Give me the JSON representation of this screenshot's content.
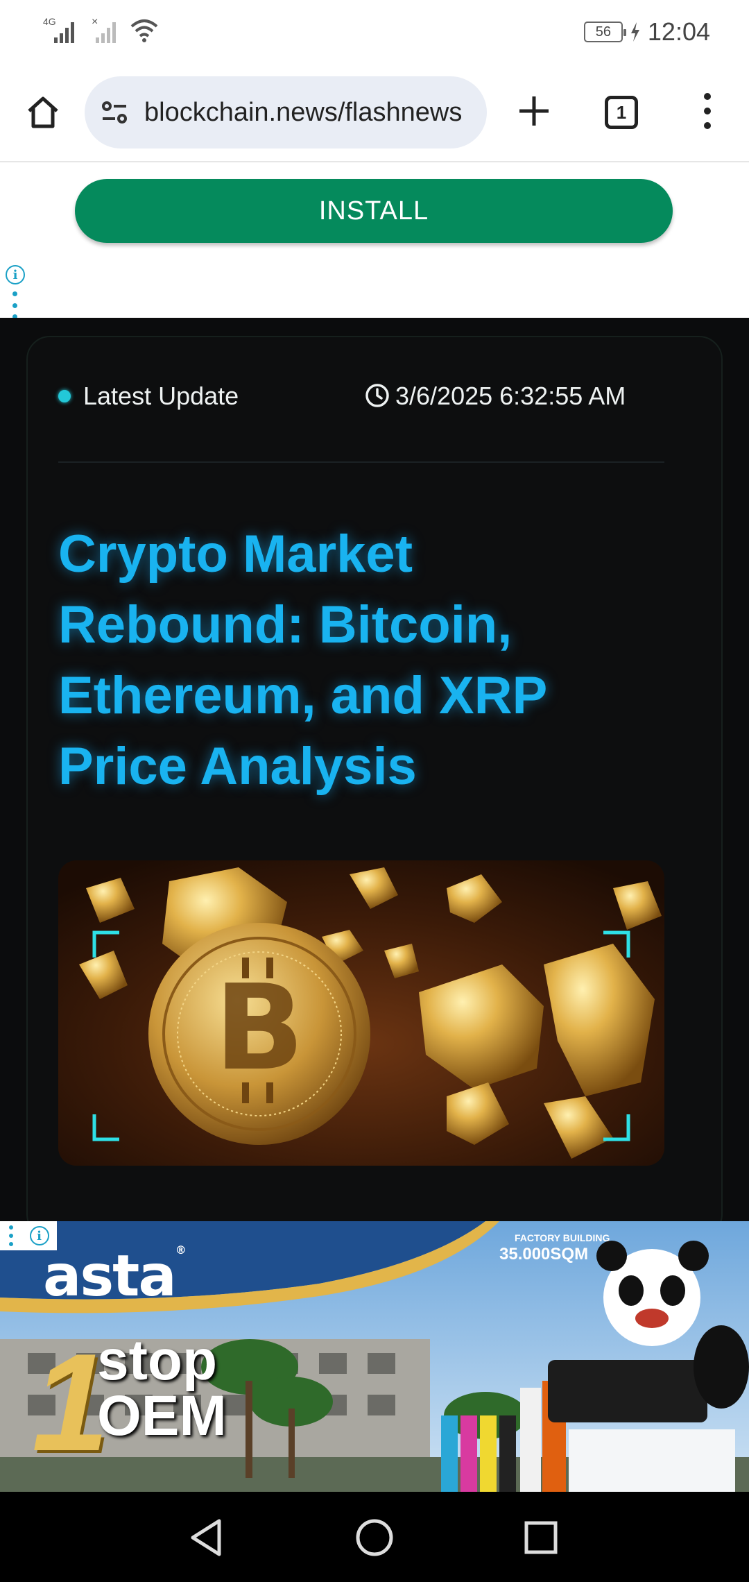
{
  "status_bar": {
    "network": "4G",
    "battery": "56",
    "time": "12:04"
  },
  "browser": {
    "url": "blockchain.news/flashnews",
    "tab_count": "1"
  },
  "top_ad": {
    "install_label": "INSTALL"
  },
  "article": {
    "badge": "Latest Update",
    "timestamp": "3/6/2025 6:32:55 AM",
    "title": "Crypto Market Rebound: Bitcoin, Ethereum, and XRP Price Analysis",
    "image": "bitcoin-gold-nuggets"
  },
  "bottom_ad": {
    "brand": "asta",
    "brand_mark": "®",
    "factory_label": "FACTORY BUILDING",
    "factory_size": "35.000SQM",
    "slogan_number": "1",
    "slogan_line1": "stop",
    "slogan_line2": "OEM"
  },
  "colors": {
    "install_green": "#058a5c",
    "title_cyan": "#19b3f0",
    "accent_dot": "#23c8d8",
    "page_bg": "#0b0c0d"
  },
  "nav": {
    "back": "back-icon",
    "home": "home-circle-icon",
    "recents": "recents-square-icon"
  }
}
